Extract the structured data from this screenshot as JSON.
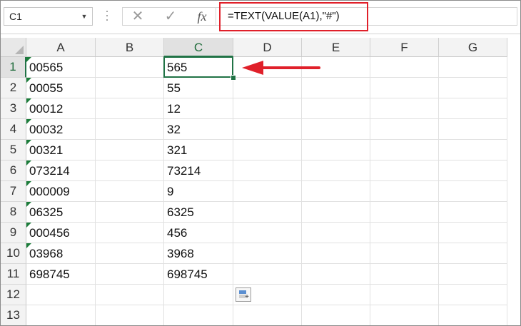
{
  "name_box": {
    "value": "C1",
    "dropdown_icon": "chevron-down-icon"
  },
  "formula_bar": {
    "cancel_icon": "cancel-x-icon",
    "enter_icon": "check-icon",
    "fx_label": "fx",
    "formula": "=TEXT(VALUE(A1),\"#\")",
    "highlight_color": "#e0202a"
  },
  "columns": [
    "A",
    "B",
    "C",
    "D",
    "E",
    "F",
    "G"
  ],
  "active_column": "C",
  "rows": [
    {
      "num": "1",
      "A": "00565",
      "B": "",
      "C": "565"
    },
    {
      "num": "2",
      "A": "00055",
      "B": "",
      "C": "55"
    },
    {
      "num": "3",
      "A": "00012",
      "B": "",
      "C": "12"
    },
    {
      "num": "4",
      "A": "00032",
      "B": "",
      "C": "32"
    },
    {
      "num": "5",
      "A": "00321",
      "B": "",
      "C": "321"
    },
    {
      "num": "6",
      "A": "073214",
      "B": "",
      "C": "73214"
    },
    {
      "num": "7",
      "A": "000009",
      "B": "",
      "C": "9"
    },
    {
      "num": "8",
      "A": "06325",
      "B": "",
      "C": "6325"
    },
    {
      "num": "9",
      "A": "000456",
      "B": "",
      "C": "456"
    },
    {
      "num": "10",
      "A": "03968",
      "B": "",
      "C": "3968"
    },
    {
      "num": "11",
      "A": "698745",
      "B": "",
      "C": "698745"
    },
    {
      "num": "12",
      "A": "",
      "B": "",
      "C": ""
    },
    {
      "num": "13",
      "A": "",
      "B": "",
      "C": ""
    }
  ],
  "number_stored_as_text_rows": [
    "1",
    "2",
    "3",
    "4",
    "5",
    "6",
    "7",
    "8",
    "9",
    "10"
  ],
  "selected_cell": "C1",
  "accent_color": "#217346",
  "annotation_arrow_color": "#e0202a",
  "paste_options_icon": "paste-options-icon"
}
